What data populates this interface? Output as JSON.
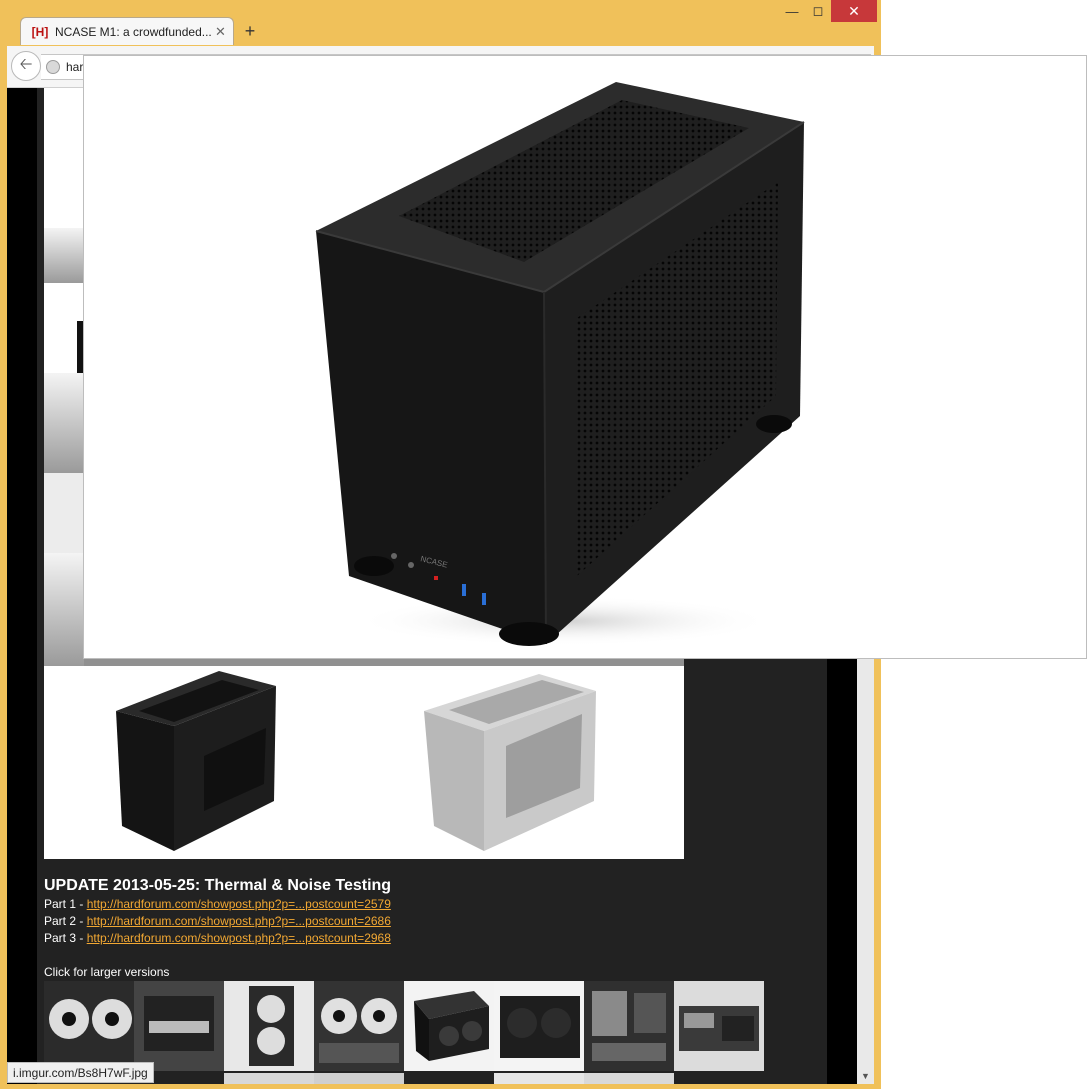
{
  "browser": {
    "tab_title": "NCASE M1: a crowdfunded...",
    "tab_favicon": "[H]",
    "url_visible": "har",
    "status_url": "i.imgur.com/Bs8H7wF.jpg"
  },
  "page": {
    "update_title": "UPDATE 2013-05-25: Thermal & Noise Testing",
    "parts": [
      {
        "label": "Part 1 - ",
        "link": "http://hardforum.com/showpost.php?p=...postcount=2579"
      },
      {
        "label": "Part 2 - ",
        "link": "http://hardforum.com/showpost.php?p=...postcount=2686"
      },
      {
        "label": "Part 3 - ",
        "link": "http://hardforum.com/showpost.php?p=...postcount=2968"
      }
    ],
    "click_note": "Click for larger versions"
  },
  "popup": {
    "case_brand": "NCASE"
  },
  "colors": {
    "accent_link": "#f2a833",
    "page_bg": "#222222",
    "window_frame": "#f0c15a",
    "close_button": "#c7383a"
  }
}
